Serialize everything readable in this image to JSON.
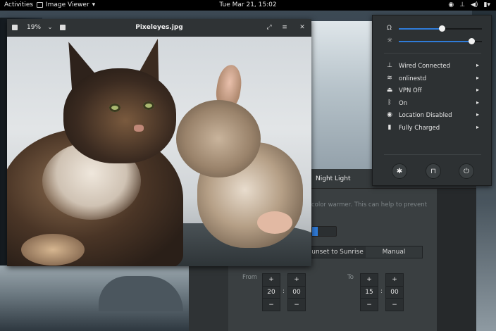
{
  "topbar": {
    "activities": "Activities",
    "app_menu": "Image Viewer",
    "app_menu_arrow": "▾",
    "clock": "Tue Mar 21, 15:02",
    "status_icons": [
      "accessibility-icon",
      "network-wired-icon",
      "volume-icon",
      "battery-icon"
    ]
  },
  "viewer": {
    "title": "Pixeleyes.jpg",
    "zoom": "19%",
    "icons": {
      "zoom_out": "zoom-out-icon",
      "zoom_menu": "chevron-down-icon",
      "zoom_in": "zoom-in-icon",
      "fullscreen": "fullscreen-icon",
      "menu": "hamburger-menu-icon",
      "close": "close-icon"
    }
  },
  "settings": {
    "title": "Night Light",
    "description": "color warmer. This can help to prevent",
    "schedule": {
      "option_auto": "unset to Sunrise",
      "option_manual": "Manual"
    },
    "from_label": "From",
    "to_label": "To",
    "from": {
      "hours": "20",
      "minutes": "00"
    },
    "to": {
      "hours": "15",
      "minutes": "00"
    },
    "plus": "+",
    "minus": "−",
    "colon": ":"
  },
  "quick_settings": {
    "volume_level": 0.52,
    "brightness_level": 0.87,
    "items": [
      {
        "icon": "network-wired-icon",
        "glyph": "⊥",
        "label": "Wired Connected"
      },
      {
        "icon": "wifi-icon",
        "glyph": "≋",
        "label": "onlinestd"
      },
      {
        "icon": "vpn-lock-icon",
        "glyph": "⏏",
        "label": "VPN Off"
      },
      {
        "icon": "bluetooth-icon",
        "glyph": "ᛒ",
        "label": "On"
      },
      {
        "icon": "location-icon",
        "glyph": "◉",
        "label": "Location Disabled"
      },
      {
        "icon": "battery-icon",
        "glyph": "▮",
        "label": "Fully Charged"
      }
    ],
    "arrow": "▸",
    "actions": [
      "settings-icon",
      "lock-icon",
      "power-icon"
    ]
  },
  "colors": {
    "accent": "#2f7bd8",
    "panel": "#2d3133",
    "topbar": "#000000"
  }
}
